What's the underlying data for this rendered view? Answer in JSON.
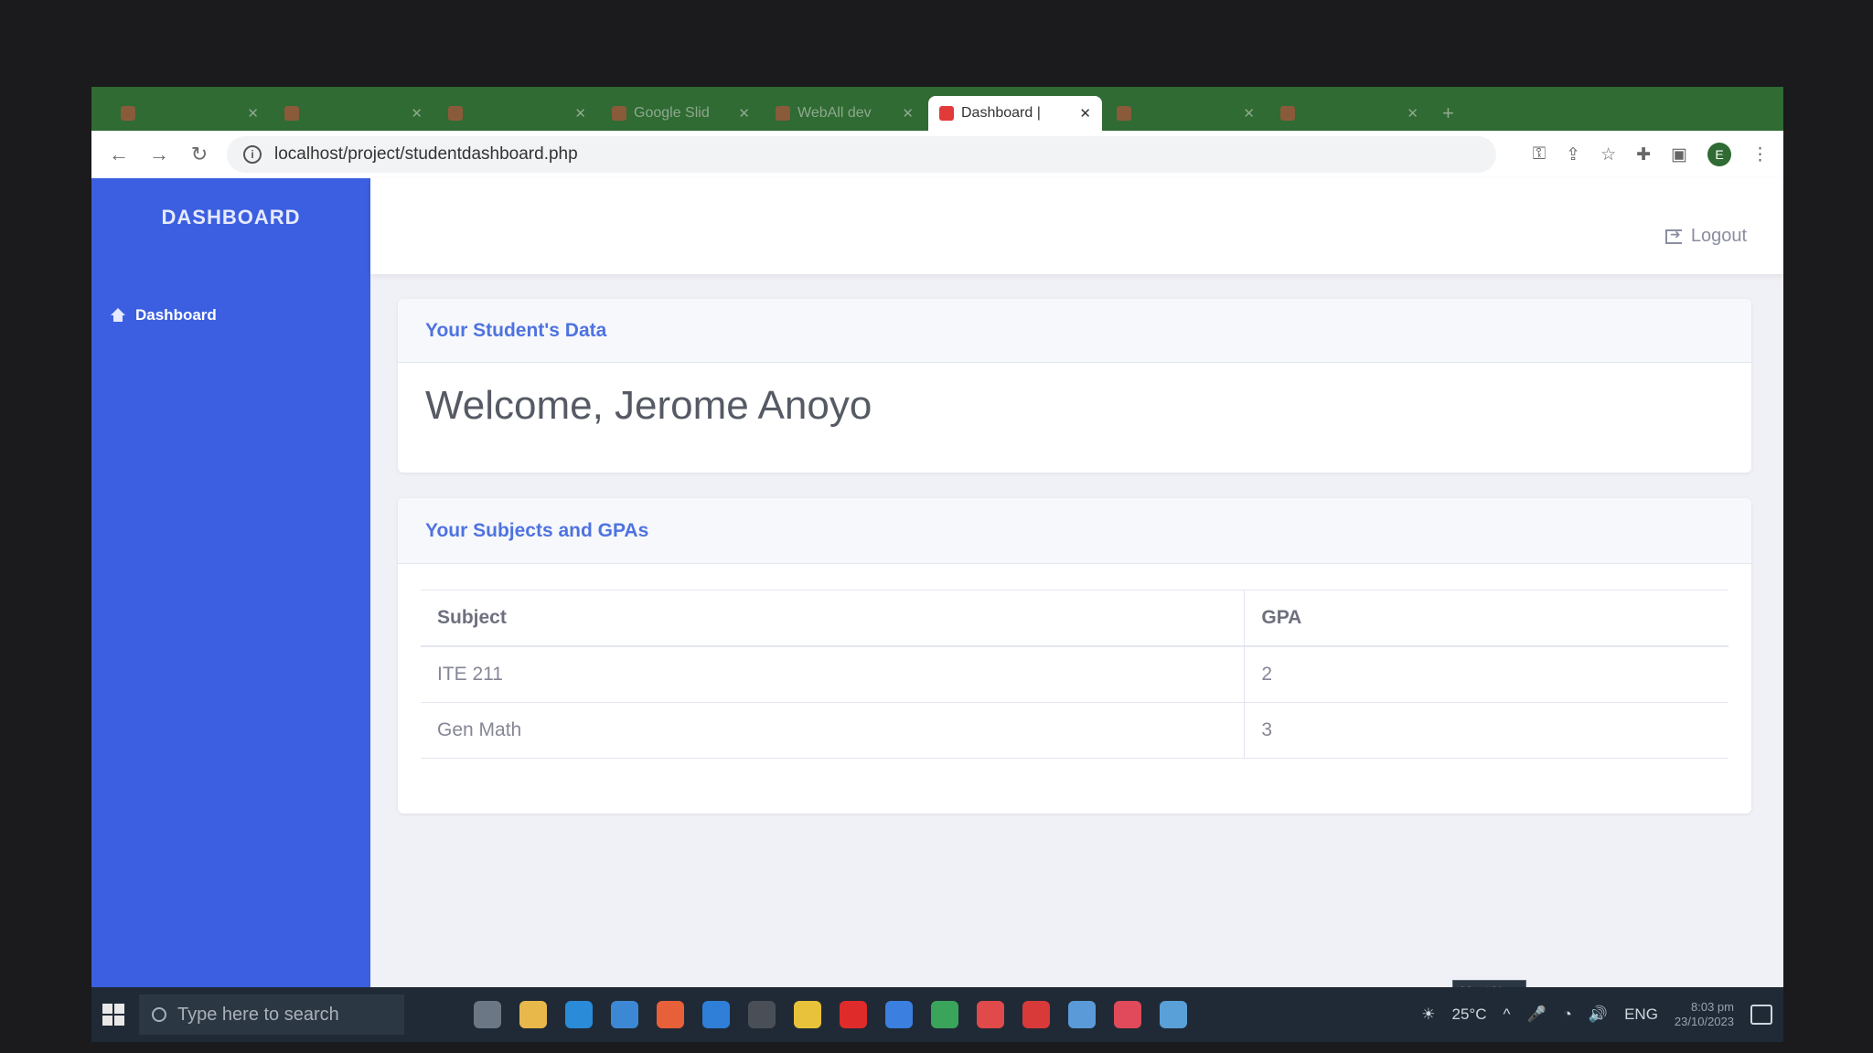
{
  "browser": {
    "tabs": [
      {
        "label": "",
        "active": false
      },
      {
        "label": "",
        "active": false
      },
      {
        "label": "",
        "active": false
      },
      {
        "label": "Google Slid",
        "active": false
      },
      {
        "label": "WebAll dev",
        "active": false
      },
      {
        "label": "Dashboard |",
        "active": true
      },
      {
        "label": "",
        "active": false
      },
      {
        "label": "",
        "active": false
      }
    ],
    "url": "localhost/project/studentdashboard.php",
    "profile_initial": "E"
  },
  "sidebar": {
    "brand": "DASHBOARD",
    "items": [
      {
        "label": "Dashboard"
      }
    ]
  },
  "topbar": {
    "logout_label": "Logout"
  },
  "student_card": {
    "title": "Your Student's Data",
    "welcome": "Welcome, Jerome Anoyo"
  },
  "subjects_card": {
    "title": "Your Subjects and GPAs",
    "columns": [
      "Subject",
      "GPA"
    ],
    "rows": [
      {
        "subject": "ITE 211",
        "gpa": "2"
      },
      {
        "subject": "Gen Math",
        "gpa": "3"
      }
    ]
  },
  "taskbar": {
    "search_placeholder": "Type here to search",
    "weather": "25°C",
    "language": "ENG",
    "time": "8:03 pm",
    "date": "23/10/2023",
    "tooltip": "Meet Now"
  },
  "colors": {
    "sidebar": "#3b5fe0",
    "accent": "#4e73df",
    "tabbar": "#2f6b32"
  }
}
